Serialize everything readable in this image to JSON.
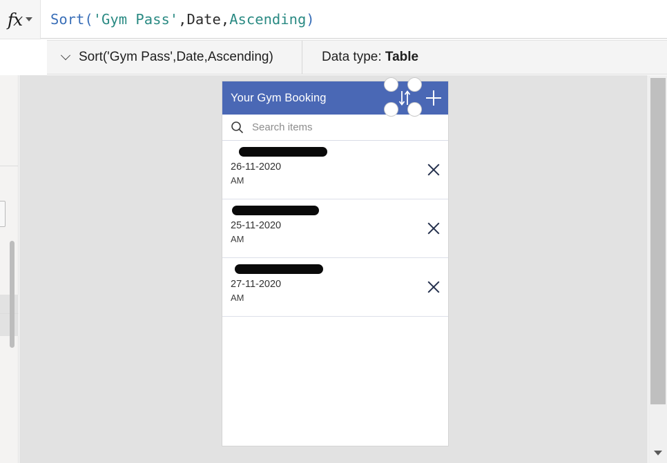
{
  "formula_bar": {
    "fx_icon": "fx-icon",
    "chevron_icon": "chevron-down-icon",
    "tokens": {
      "fn": "Sort(",
      "string": "'Gym Pass'",
      "comma1": ",",
      "field": "Date",
      "comma2": ",",
      "enum": "Ascending",
      "close": ")"
    }
  },
  "result_bar": {
    "chevron_icon": "chevron-down-icon",
    "expression": "Sort('Gym Pass',Date,Ascending)",
    "data_type_label": "Data type: ",
    "data_type_value": "Table"
  },
  "gallery": {
    "header": {
      "title": "Your Gym Booking",
      "sort_icon": "sort-arrows-icon",
      "add_icon": "plus-icon",
      "background_color": "#4a68b5"
    },
    "search": {
      "icon": "search-icon",
      "placeholder": "Search items"
    },
    "items": [
      {
        "name": "",
        "date": "26-11-2020",
        "time": "AM",
        "delete_icon": "close-icon"
      },
      {
        "name": "",
        "date": "25-11-2020",
        "time": "AM",
        "delete_icon": "close-icon"
      },
      {
        "name": "",
        "date": "27-11-2020",
        "time": "AM",
        "delete_icon": "close-icon"
      }
    ]
  },
  "scrollbars": {
    "vertical_arrow_icon": "chevron-down-icon"
  },
  "colors": {
    "accent_blue": "#4a68b5",
    "canvas_gray": "#e2e2e2",
    "formula_fn": "#3a6fb8",
    "formula_string": "#2a8a83"
  }
}
